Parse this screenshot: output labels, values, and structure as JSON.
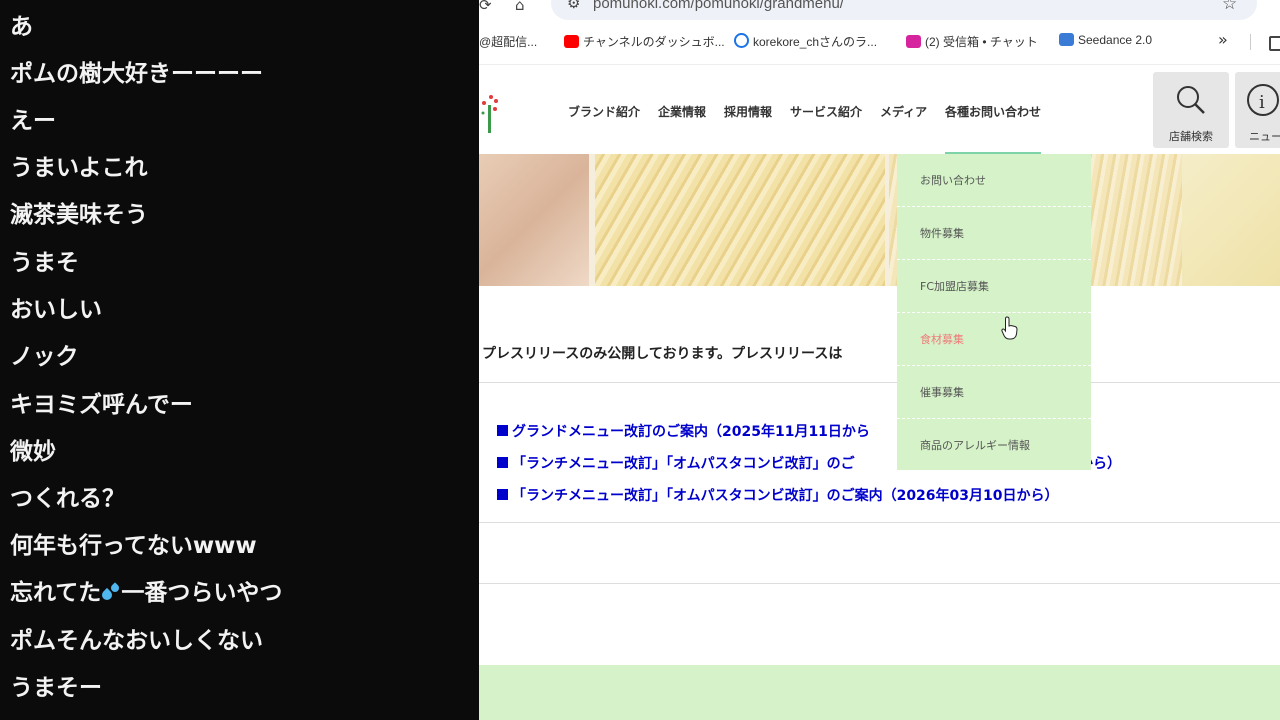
{
  "chat": {
    "messages": [
      "あ",
      "ポムの樹大好きーーーー",
      "えー",
      "うまいよこれ",
      "滅茶美味そう",
      "うまそ",
      "おいしい",
      "ノック",
      "キヨミズ呼んでー",
      "微妙",
      "つくれる？",
      "何年も行ってないwww",
      "忘れてた💦一番つらいやつ",
      "ポムそんなおいしくない",
      "うまそー"
    ],
    "msg13_before": "忘れてた",
    "msg13_after": "一番つらいやつ"
  },
  "browser": {
    "url": "pomunoki.com/pomunoki/grandmenu/",
    "bookmarks": [
      {
        "label": "@超配信...",
        "icon_color": "#ffffff"
      },
      {
        "label": "チャンネルのダッシュボ...",
        "icon_color": "#ff0000"
      },
      {
        "label": "korekore_chさんのラ...",
        "icon_color": "#1a73e8"
      },
      {
        "label": "(2) 受信箱 • チャット",
        "icon_color": "#d6249f"
      },
      {
        "label": "Seedance 2.0",
        "icon_color": "#3a7bd5"
      }
    ],
    "more": "»"
  },
  "site": {
    "nav": [
      "ブランド紹介",
      "企業情報",
      "採用情報",
      "サービス紹介",
      "メディア",
      "各種お問い合わせ"
    ],
    "search_label": "店舗検索",
    "news_label": "ニュー",
    "intro": "プレスリリースのみ公開しております。プレスリリースは",
    "news_items": [
      "グランドメニュー改訂のご案内（2025年11月11日から",
      "「ランチメニュー改訂」「オムパスタコンビ改訂」のご",
      "「ランチメニュー改訂」「オムパスタコンビ改訂」のご案内（2026年03月10日から）"
    ],
    "news_2_tail": "から）",
    "dropdown": [
      "お問い合わせ",
      "物件募集",
      "FC加盟店募集",
      "食材募集",
      "催事募集",
      "商品のアレルギー情報"
    ],
    "dropdown_active_index": 3,
    "accent_color": "#7fd3a8",
    "menu_bg": "#d5f2c8",
    "link_color": "#0000cc"
  }
}
